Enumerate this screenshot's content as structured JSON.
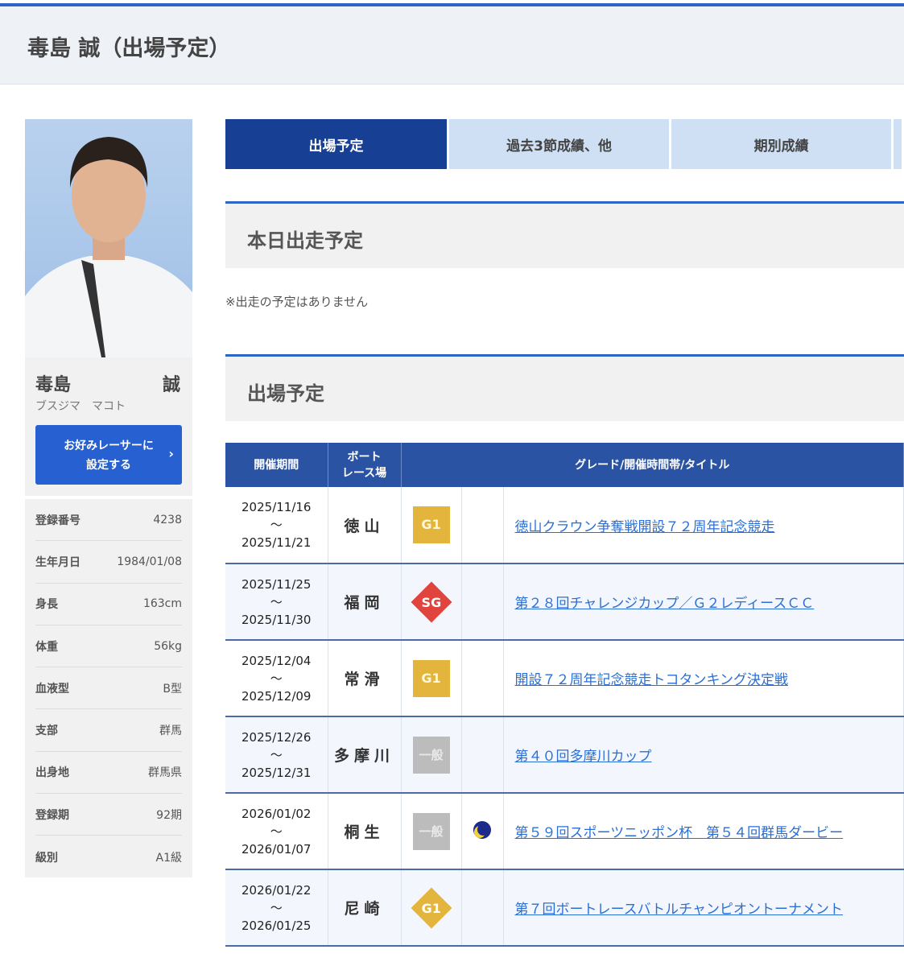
{
  "header": {
    "title": "毒島 誠（出場予定）"
  },
  "profile": {
    "surname": "毒島",
    "given": "誠",
    "kana": "ブスジマ　マコト",
    "fav_button_line1": "お好みレーサーに",
    "fav_button_line2": "設定する",
    "info": [
      {
        "k": "登録番号",
        "v": "4238"
      },
      {
        "k": "生年月日",
        "v": "1984/01/08"
      },
      {
        "k": "身長",
        "v": "163cm"
      },
      {
        "k": "体重",
        "v": "56kg"
      },
      {
        "k": "血液型",
        "v": "B型"
      },
      {
        "k": "支部",
        "v": "群馬"
      },
      {
        "k": "出身地",
        "v": "群馬県"
      },
      {
        "k": "登録期",
        "v": "92期"
      },
      {
        "k": "級別",
        "v": "A1級"
      }
    ]
  },
  "tabs": [
    "出場予定",
    "過去3節成績、他",
    "期別成績"
  ],
  "today": {
    "title": "本日出走予定",
    "note": "※出走の予定はありません"
  },
  "schedule": {
    "title": "出場予定",
    "headers": {
      "period": "開催期間",
      "venue1": "ボート",
      "venue2": "レース場",
      "grade": "グレード/開催時間帯/タイトル"
    },
    "rows": [
      {
        "start": "2025/11/16",
        "sep": "〜",
        "end": "2025/11/21",
        "venue": "徳山",
        "grade": "G1",
        "title": "徳山クラウン争奪戦開設７２周年記念競走"
      },
      {
        "start": "2025/11/25",
        "sep": "〜",
        "end": "2025/11/30",
        "venue": "福岡",
        "grade": "SG",
        "title": "第２８回チャレンジカップ／Ｇ２レディースＣＣ"
      },
      {
        "start": "2025/12/04",
        "sep": "〜",
        "end": "2025/12/09",
        "venue": "常滑",
        "grade": "G1",
        "title": "開設７２周年記念競走トコタンキング決定戦"
      },
      {
        "start": "2025/12/26",
        "sep": "〜",
        "end": "2025/12/31",
        "venue": "多摩川",
        "grade": "一般",
        "title": "第４０回多摩川カップ"
      },
      {
        "start": "2026/01/02",
        "sep": "〜",
        "end": "2026/01/07",
        "venue": "桐生",
        "grade": "一般",
        "time": "night",
        "title": "第５９回スポーツニッポン杯　第５４回群馬ダービー"
      },
      {
        "start": "2026/01/22",
        "sep": "〜",
        "end": "2026/01/25",
        "venue": "尼崎",
        "grade": "G1",
        "title": "第７回ボートレースバトルチャンピオントーナメント"
      }
    ]
  }
}
